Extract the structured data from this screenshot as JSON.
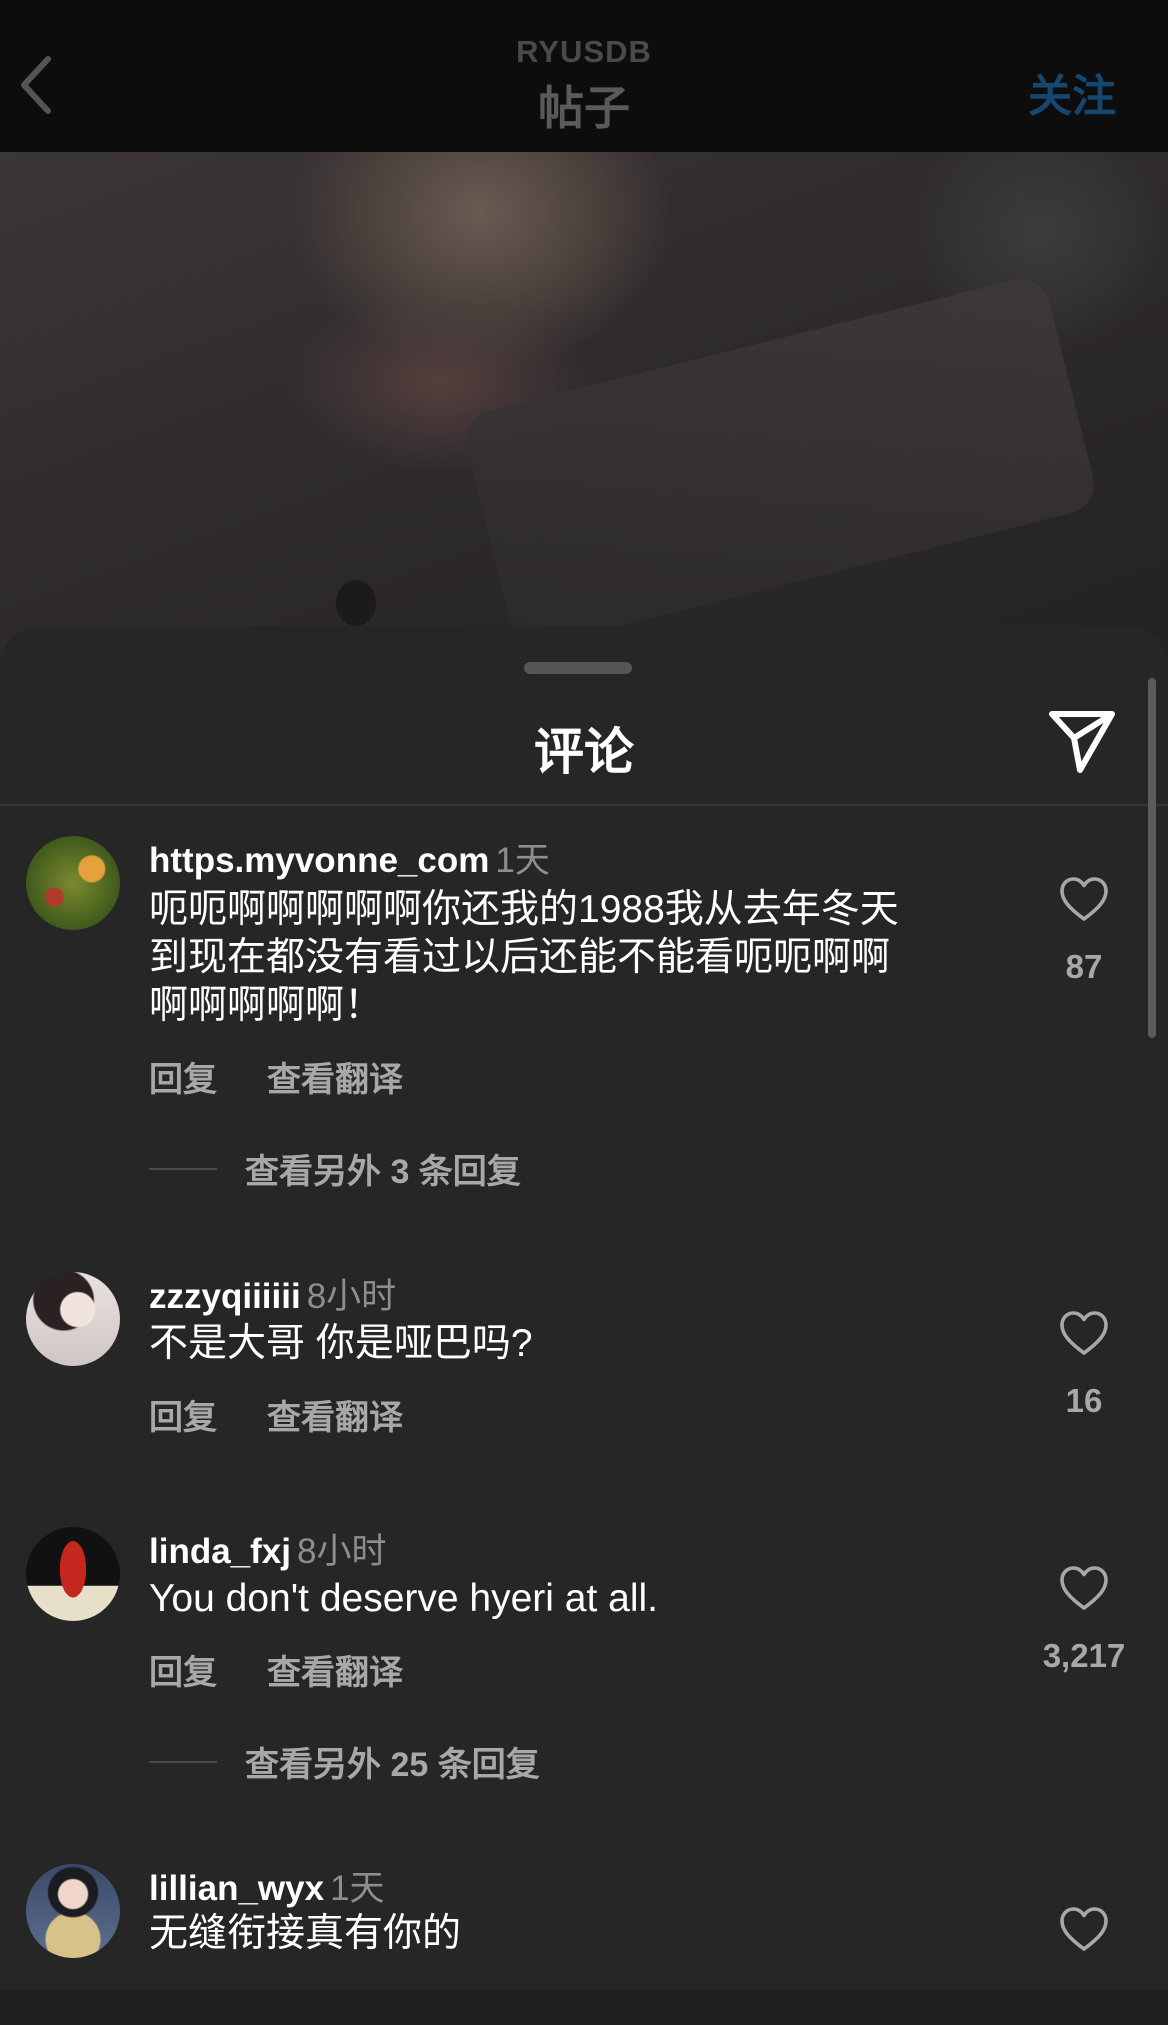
{
  "topbar": {
    "account": "RYUSDB",
    "title": "帖子",
    "follow_label": "关注"
  },
  "sheet": {
    "title": "评论"
  },
  "comments": [
    {
      "username": "https.myvonne_com",
      "time": "1天",
      "text": "呃呃啊啊啊啊啊你还我的1988我从去年冬天\n到现在都没有看过以后还能不能看呃呃啊啊\n啊啊啊啊啊！",
      "reply_label": "回复",
      "translate_label": "查看翻译",
      "likes": "87",
      "more_replies": "查看另外 3 条回复"
    },
    {
      "username": "zzzyqiiiiii",
      "time": "8小时",
      "text": "不是大哥 你是哑巴吗?",
      "reply_label": "回复",
      "translate_label": "查看翻译",
      "likes": "16"
    },
    {
      "username": "linda_fxj",
      "time": "8小时",
      "text": "You don't deserve hyeri at all.",
      "reply_label": "回复",
      "translate_label": "查看翻译",
      "likes": "3,217",
      "more_replies": "查看另外 25 条回复"
    },
    {
      "username": "lillian_wyx",
      "time": "1天",
      "text": "无缝衔接真有你的"
    }
  ],
  "icons": {
    "back": "chevron-left-icon",
    "share": "paper-plane-icon",
    "like": "heart-outline-icon"
  },
  "colors": {
    "background": "#262626",
    "topbar": "#0d0d0d",
    "follow": "#15476f",
    "secondary_text": "#a8a8a8"
  }
}
